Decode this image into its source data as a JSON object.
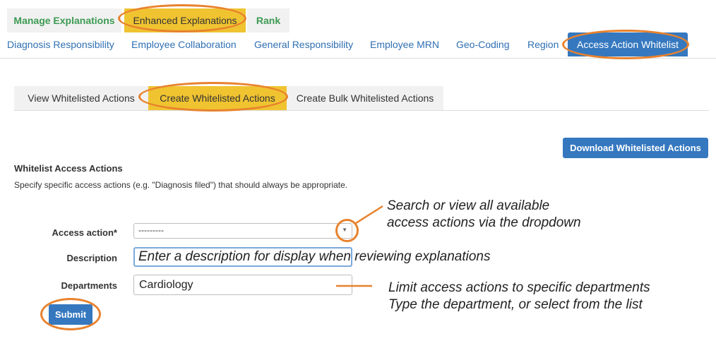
{
  "top_tabs": [
    {
      "label": "Manage Explanations"
    },
    {
      "label": "Enhanced Explanations"
    },
    {
      "label": "Rank"
    }
  ],
  "sub_nav": [
    {
      "label": "Diagnosis Responsibility"
    },
    {
      "label": "Employee Collaboration"
    },
    {
      "label": "General Responsibility"
    },
    {
      "label": "Employee MRN"
    },
    {
      "label": "Geo-Coding"
    },
    {
      "label": "Region"
    },
    {
      "label": "Access Action Whitelist"
    }
  ],
  "action_tabs": [
    {
      "label": "View Whitelisted Actions"
    },
    {
      "label": "Create Whitelisted Actions"
    },
    {
      "label": "Create Bulk Whitelisted Actions"
    }
  ],
  "download_button": "Download Whitelisted Actions",
  "section": {
    "title": "Whitelist Access Actions",
    "description": "Specify specific access actions (e.g. \"Diagnosis filed\") that should always be appropriate."
  },
  "form": {
    "access_action": {
      "label": "Access action*",
      "value": "---------"
    },
    "description": {
      "label": "Description",
      "value": ""
    },
    "departments": {
      "label": "Departments",
      "value": "Cardiology"
    },
    "submit": "Submit"
  },
  "annotations": {
    "dropdown_line1": "Search or view all available",
    "dropdown_line2": "access actions via the dropdown",
    "description_hint": "Enter a description for display when reviewing explanations",
    "departments_line1": "Limit access actions to specific departments",
    "departments_line2": "Type the department, or select from the list"
  },
  "colors": {
    "accent_orange": "#e8822e",
    "highlight_yellow": "#f0c330",
    "primary_blue": "#3578bf",
    "tab_green": "#3c9a52"
  }
}
